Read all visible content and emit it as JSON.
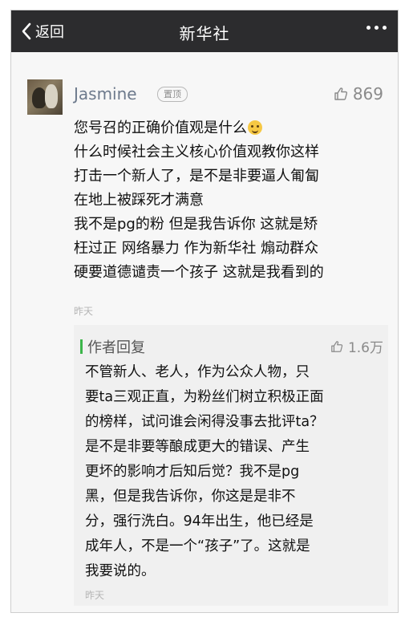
{
  "nav": {
    "back_label": "返回",
    "title": "新华社"
  },
  "comment": {
    "username": "Jasmine",
    "pinned_badge": "置顶",
    "likes": "869",
    "lines": [
      "您号召的正确价值观是什么",
      "什么时候社会主义核心价值观教你这样",
      "打击一个新人了，是不是非要逼人匍匐",
      "在地上被踩死才满意",
      "我不是pg的粉 但是我告诉你 这就是矫",
      "枉过正 网络暴力 作为新华社 煽动群众",
      "硬要道德谴责一个孩子 这就是我看到的"
    ],
    "time": "昨天"
  },
  "reply": {
    "label": "作者回复",
    "likes": "1.6万",
    "lines": [
      "不管新人、老人，作为公众人物，只",
      "要ta三观正直，为粉丝们树立积极正面",
      "的榜样，试问谁会闲得没事去批评ta？",
      "是不是非要等酿成更大的错误、产生",
      "更坏的影响才后知后觉？我不是pg",
      "黑，但是我告诉你，你这是是非不",
      "分，强行洗白。94年出生，他已经是",
      "成年人，不是一个“孩子”了。这就是",
      "我要说的。"
    ],
    "time": "昨天"
  }
}
